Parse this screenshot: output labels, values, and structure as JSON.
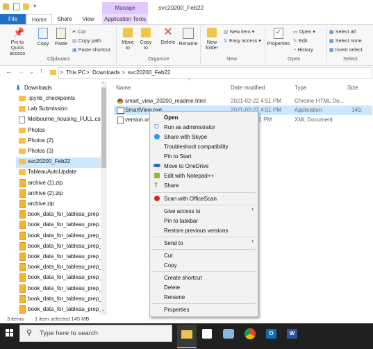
{
  "window": {
    "title": "svc20200_Feb22"
  },
  "ribbon_tabs": {
    "file": "File",
    "home": "Home",
    "share": "Share",
    "view": "View",
    "manage": "Manage",
    "app_tools": "Application Tools"
  },
  "clipboard": {
    "pin_quick": "Pin to Quick",
    "pin_quick2": "access",
    "copy": "Copy",
    "paste": "Paste",
    "cut": "Cut",
    "copy_path": "Copy path",
    "paste_shortcut": "Paste shortcut",
    "label": "Clipboard"
  },
  "organize": {
    "move": "Move",
    "move2": "to",
    "copy": "Copy",
    "copy2": "to",
    "delete": "Delete",
    "rename": "Rename",
    "label": "Organize"
  },
  "new": {
    "new_folder": "New",
    "new_folder2": "folder",
    "new_item": "New item",
    "easy_access": "Easy access",
    "label": "New"
  },
  "open": {
    "properties": "Properties",
    "open": "Open",
    "edit": "Edit",
    "history": "History",
    "label": "Open"
  },
  "select": {
    "select_all": "Select all",
    "select_none": "Select none",
    "invert": "Invert select",
    "label": "Select"
  },
  "address": {
    "crumbs": [
      "This PC",
      "Downloads",
      "svc20200_Feb22"
    ],
    "sep": ">"
  },
  "nav": {
    "items": [
      "Downloads",
      ".ipynb_checkpoints",
      "Lab Submission",
      "Melbourne_housing_FULL.csv",
      "Photos",
      "Photos (2)",
      "Photos (3)",
      "svc20200_Feb22",
      "TableauAutoUpdate",
      "archive (1).zip",
      "archive (2).zip",
      "archive.zip",
      "book_data_for_tableau_prep (1",
      "book_data_for_tableau_prep.zi",
      "book_data_for_tableau_prep_0.",
      "book_data_for_tableau_prep_1.",
      "book_data_for_tableau_prep_2",
      "book_data_for_tableau_prep_2.",
      "book_data_for_tableau_prep_3",
      "book_data_for_tableau_prep_3.",
      "book_data_for_tableau_prep_4.",
      "book_data_for_tableau_prep_8."
    ]
  },
  "columns": {
    "name": "Name",
    "date": "Date modified",
    "type": "Type",
    "size": "Size"
  },
  "files": [
    {
      "name": "smart_view_20200_readme.html",
      "date": "2021-02-22 4:51 PM",
      "type": "Chrome HTML Do...",
      "size": ""
    },
    {
      "name": "SmartView.exe",
      "date": "2021-02-22 4:51 PM",
      "type": "Application",
      "size": "149,"
    },
    {
      "name": "version.xml",
      "date": "51 PM",
      "type": "XML Document",
      "size": ""
    }
  ],
  "context_menu": {
    "open": "Open",
    "run_admin": "Run as administrator",
    "skype": "Share with Skype",
    "troubleshoot": "Troubleshoot compatibility",
    "pin_start": "Pin to Start",
    "onedrive": "Move to OneDrive",
    "notepad": "Edit with Notepad++",
    "share": "Share",
    "officescan": "Scan with OfficeScan",
    "give_access": "Give access to",
    "pin_taskbar": "Pin to taskbar",
    "restore": "Restore previous versions",
    "send_to": "Send to",
    "cut": "Cut",
    "copy": "Copy",
    "create_shortcut": "Create shortcut",
    "delete": "Delete",
    "rename": "Rename",
    "properties": "Properties"
  },
  "status": {
    "items": "3 items",
    "selected": "1 item selected  145 MB"
  },
  "taskbar": {
    "search_placeholder": "Type here to search"
  }
}
